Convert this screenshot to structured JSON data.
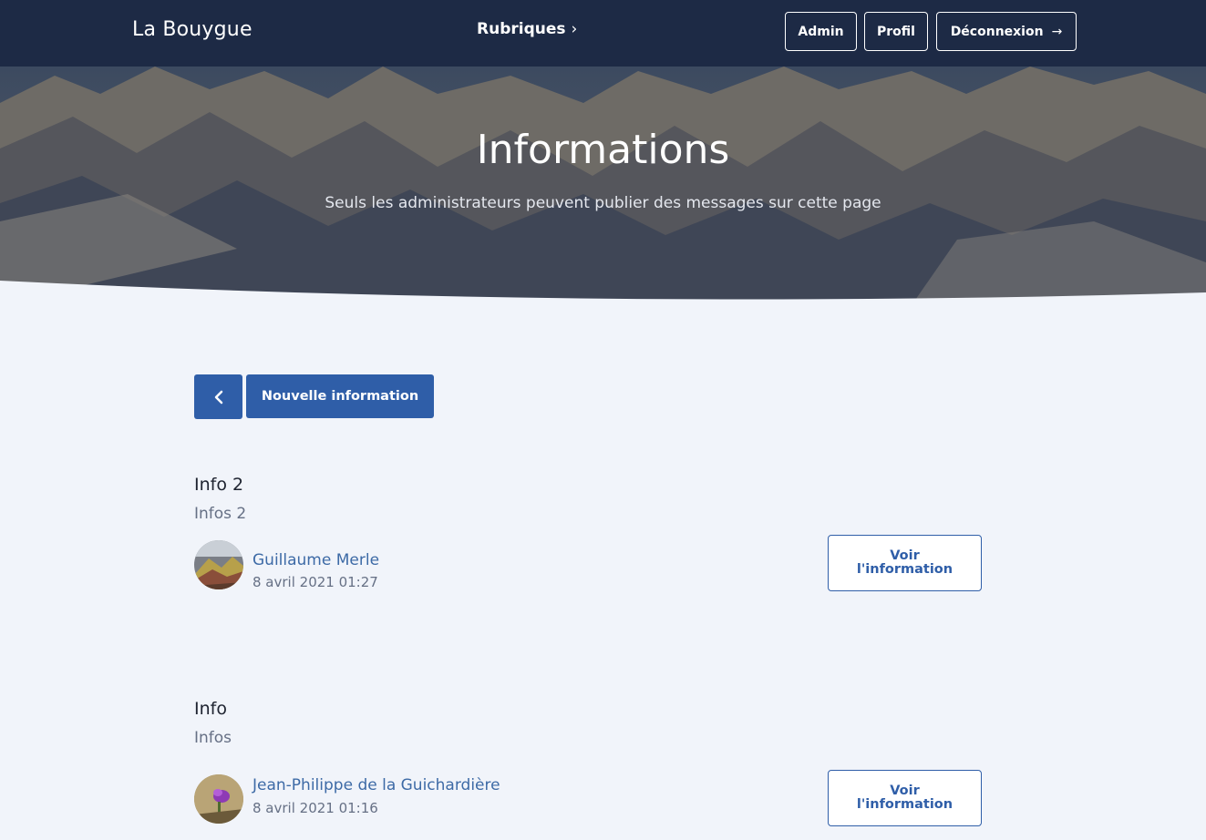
{
  "nav": {
    "brand": "La Bouygue",
    "rubriques": "Rubriques",
    "admin": "Admin",
    "profil": "Profil",
    "logout": "Déconnexion",
    "logout_icon": "arrow-right-icon",
    "background": "#1d2a45"
  },
  "hero": {
    "title": "Informations",
    "subtitle": "Seuls les administrateurs peuvent publier des messages sur cette page"
  },
  "toolbar": {
    "back_icon": "chevron-left-icon",
    "new_label": "Nouvelle information",
    "accent": "#2f5ea8"
  },
  "posts": [
    {
      "title": "Info 2",
      "body": "Infos 2",
      "author": "Guillaume Merle",
      "date": "8 avril 2021 01:27",
      "button": "Voir\nl'information"
    },
    {
      "title": "Info",
      "body": "Infos",
      "author": "Jean-Philippe de la Guichardière",
      "date": "8 avril 2021 01:16",
      "button": "Voir\nl'information"
    }
  ]
}
